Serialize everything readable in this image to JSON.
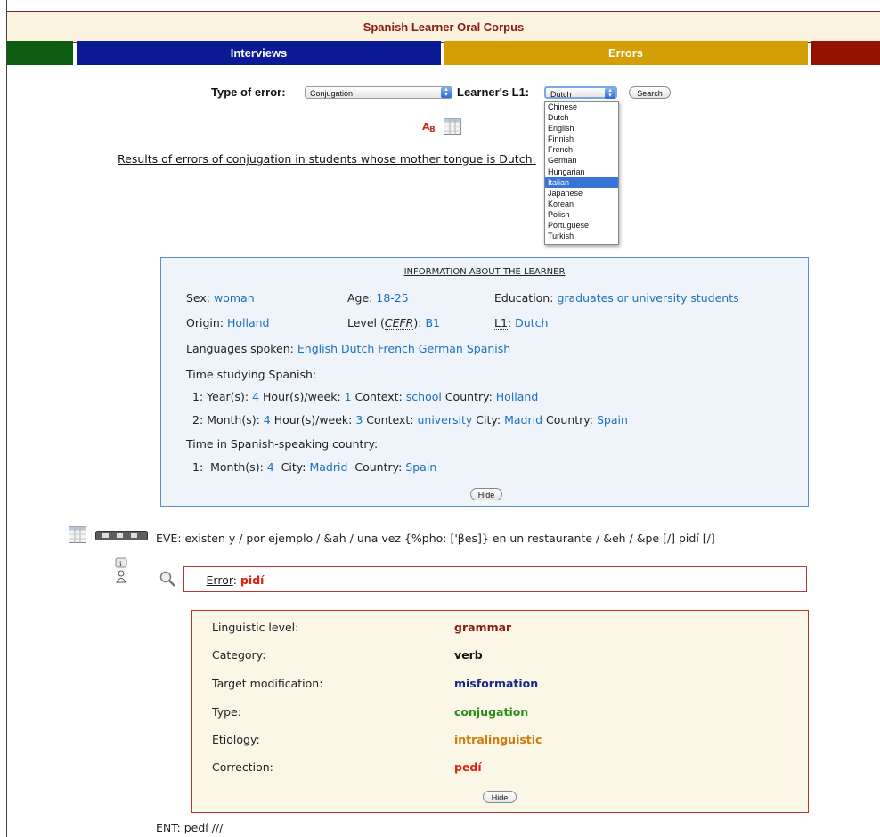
{
  "header": {
    "title": "Spanish Learner Oral Corpus"
  },
  "nav": {
    "interviews": "Interviews",
    "errors": "Errors"
  },
  "colors": {
    "green": "#0c5c12",
    "blue": "#0a1b95",
    "gold": "#d49f06",
    "red": "#951100",
    "link": "#1f6fc0"
  },
  "search": {
    "type_label": "Type of error:",
    "type_value": "Conjugation",
    "l1_label": "Learner's L1:",
    "l1_value": "Dutch",
    "search_button": "Search",
    "l1_options": [
      "Chinese",
      "Dutch",
      "English",
      "Finnish",
      "French",
      "German",
      "Hungarian",
      "Italian",
      "Japanese",
      "Korean",
      "Polish",
      "Portuguese",
      "Turkish"
    ],
    "highlighted_option": "Italian"
  },
  "results_text": "Results of errors of conjugation in students whose mother tongue is Dutch:",
  "learner": {
    "heading": "INFORMATION ABOUT THE LEARNER",
    "sex_label": "Sex:",
    "sex": "woman",
    "age_label": "Age:",
    "age": "18-25",
    "education_label": "Education:",
    "education": "graduates or university students",
    "origin_label": "Origin:",
    "origin": "Holland",
    "level_label": "Level (",
    "level_abbr": "CEFR",
    "level_label_end": "):",
    "level": "B1",
    "l1_label": "L1",
    "l1_colon": ":",
    "l1": "Dutch",
    "languages_label": "Languages spoken:",
    "languages": [
      "English",
      "Dutch",
      "French",
      "German",
      "Spanish"
    ],
    "time_studying_label": "Time studying Spanish:",
    "study": [
      {
        "num": "1:",
        "unit": "Year(s):",
        "amount": "4",
        "hours_label": "Hour(s)/week:",
        "hours": "1",
        "context_label": "Context:",
        "context": "school",
        "place_label": "Country:",
        "place": "Holland"
      },
      {
        "num": "2:",
        "unit": "Month(s):",
        "amount": "4",
        "hours_label": "Hour(s)/week:",
        "hours": "3",
        "context_label": "Context:",
        "context": "university",
        "city_label": "City:",
        "city": "Madrid",
        "place_label": "Country:",
        "place": "Spain"
      }
    ],
    "time_country_label": "Time in Spanish-speaking country:",
    "stay": {
      "num": "1:",
      "unit": "Month(s):",
      "amount": "4",
      "city_label": "City:",
      "city": "Madrid",
      "country_label": "Country:",
      "country": "Spain"
    },
    "hide_button": "Hide"
  },
  "transcript": {
    "eve_line": "EVE: existen y / por ejemplo / &ah / una vez {%pho: ['βes]} en un restaurante / &eh / &pe [/] pidí [/]",
    "error_prefix": "-",
    "error_label": "Error",
    "error_colon": ":",
    "error_word": "pidí",
    "ent_line": "ENT: pedí ///"
  },
  "error_detail": {
    "rows": [
      {
        "label": "Linguistic level:",
        "value": "grammar",
        "color": "#8b1a10"
      },
      {
        "label": "Category:",
        "value": "verb",
        "color": "#111111"
      },
      {
        "label": "Target modification:",
        "value": "misformation",
        "color": "#1a2a8a"
      },
      {
        "label": "Type:",
        "value": "conjugation",
        "color": "#2a8a1a"
      },
      {
        "label": "Etiology:",
        "value": "intralinguistic",
        "color": "#d07a10"
      },
      {
        "label": "Correction:",
        "value": "pedí",
        "color": "#e02010"
      }
    ],
    "hide_button": "Hide"
  }
}
